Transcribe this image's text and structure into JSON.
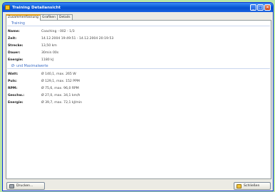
{
  "window": {
    "title": "Training Detailansicht",
    "buttons": {
      "minimize": "_",
      "maximize": "□",
      "close": "✕"
    }
  },
  "tabs": [
    {
      "label": "Zusammenfassung",
      "active": true
    },
    {
      "label": "Grafiken",
      "active": false
    },
    {
      "label": "Details",
      "active": false
    }
  ],
  "training": {
    "heading": "Training",
    "rows": [
      {
        "label": "Name:",
        "value": "Coaching - 002 - 1/3"
      },
      {
        "label": "Zeit:",
        "value": "14.12.2004 19:49:51 - 14.12.2004 20:19:53"
      },
      {
        "label": "Strecke:",
        "value": "13,50 km"
      },
      {
        "label": "Dauer:",
        "value": "30min 00s"
      },
      {
        "label": "Energie:",
        "value": "1180 kJ"
      }
    ]
  },
  "averages": {
    "heading": "Ø- und Maximalwerte",
    "rows": [
      {
        "label": "Watt:",
        "value": "Ø 140,1, max. 265 W"
      },
      {
        "label": "Puls:",
        "value": "Ø 129,1, max. 152 PPM"
      },
      {
        "label": "RPM:",
        "value": "Ø 75,6, max. 96,0 RPM"
      },
      {
        "label": "Geschw.:",
        "value": "Ø 27,0, max. 34,1 km/h"
      },
      {
        "label": "Energie:",
        "value": "Ø 39,7, max. 72,1 kJ/min"
      }
    ]
  },
  "footer": {
    "print_label": "Drucken...",
    "close_label": "Schließen",
    "print_icon": "printer-icon",
    "close_icon": "close-door-icon"
  },
  "colors": {
    "background": "#b9e7a6",
    "titlebar": "#0a5ad8",
    "section_heading": "#3d6ec7",
    "active_tab_accent": "#e5a21b"
  }
}
